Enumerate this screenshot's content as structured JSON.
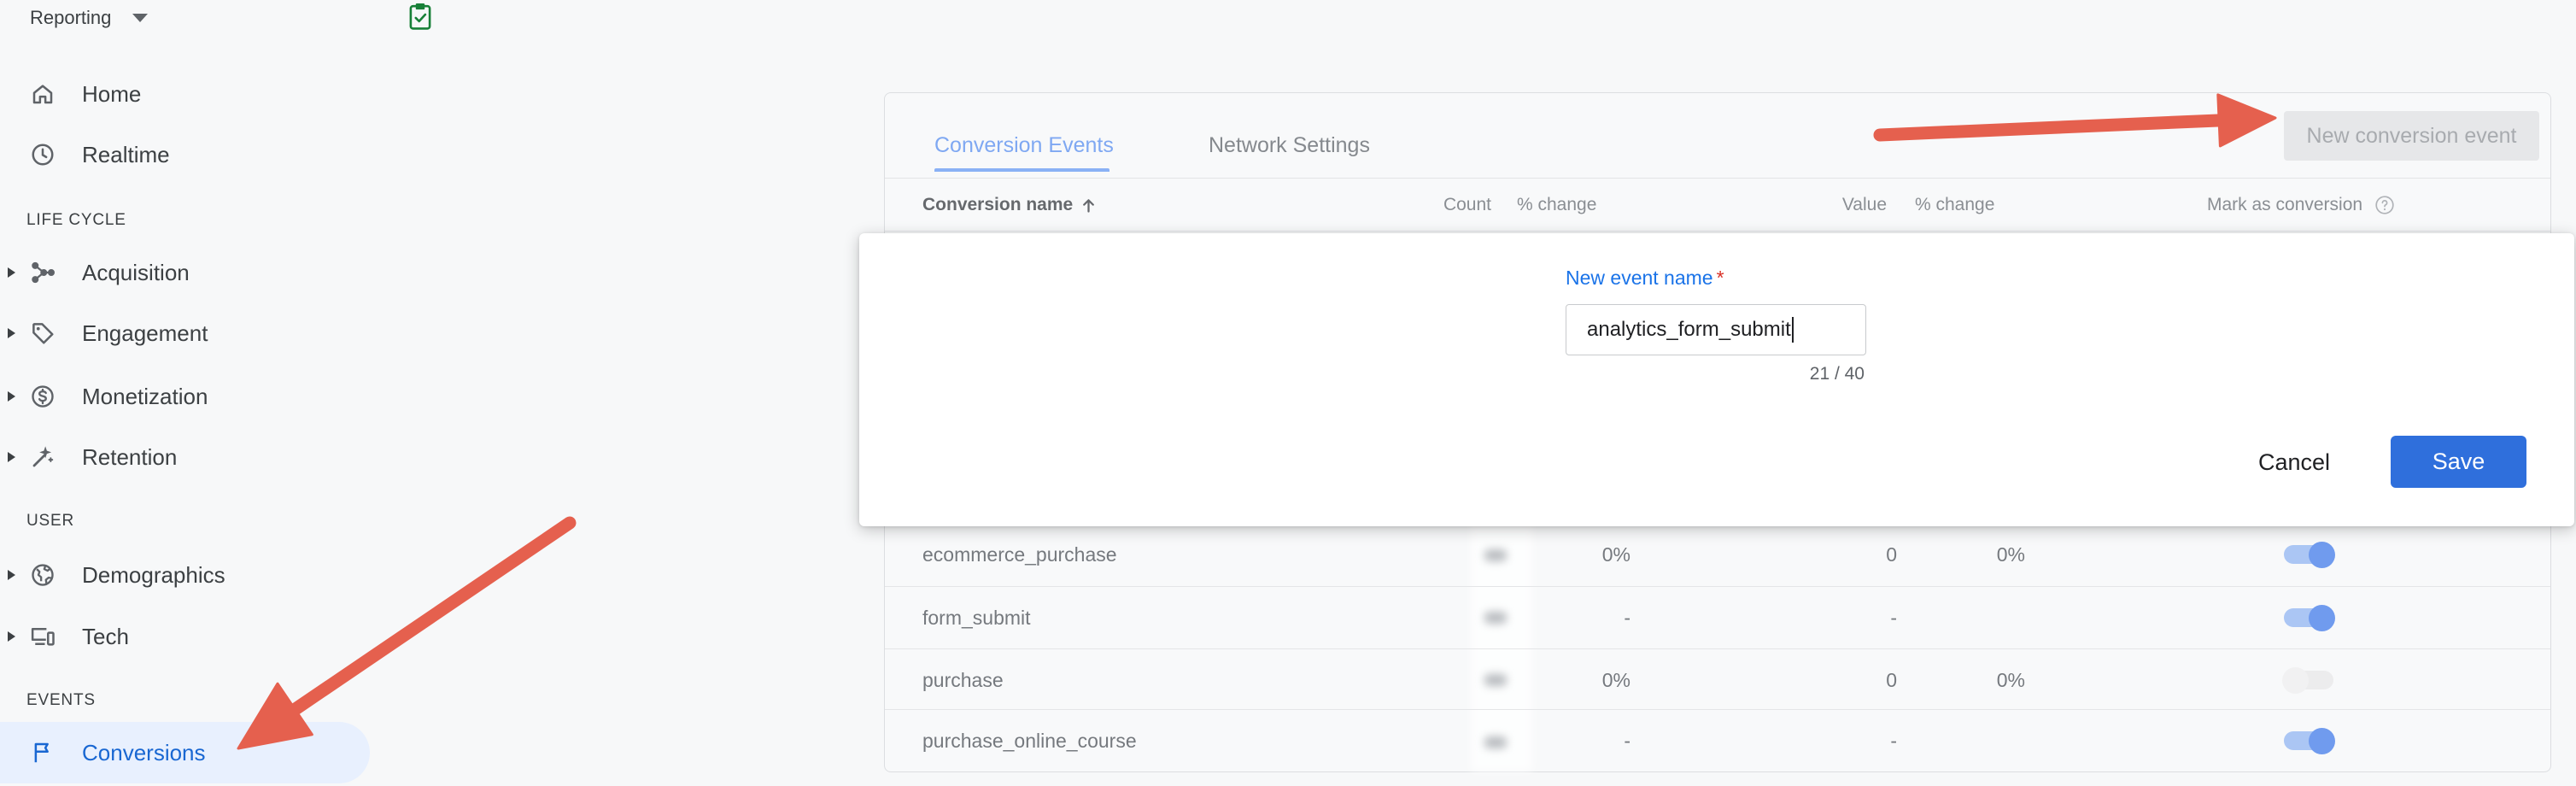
{
  "header": {
    "reporting_label": "Reporting",
    "report_icon": "clipboard-check-icon"
  },
  "sidebar": {
    "top": [
      {
        "label": "Home",
        "icon": "home-icon"
      },
      {
        "label": "Realtime",
        "icon": "clock-icon"
      }
    ],
    "sections": [
      {
        "title": "LIFE CYCLE",
        "items": [
          {
            "label": "Acquisition",
            "icon": "acquisition-icon",
            "expandable": true
          },
          {
            "label": "Engagement",
            "icon": "tag-icon",
            "expandable": true
          },
          {
            "label": "Monetization",
            "icon": "dollar-icon",
            "expandable": true
          },
          {
            "label": "Retention",
            "icon": "wand-icon",
            "expandable": true
          }
        ]
      },
      {
        "title": "USER",
        "items": [
          {
            "label": "Demographics",
            "icon": "globe-icon",
            "expandable": true
          },
          {
            "label": "Tech",
            "icon": "devices-icon",
            "expandable": true
          }
        ]
      },
      {
        "title": "EVENTS",
        "items": [
          {
            "label": "Conversions",
            "icon": "flag-icon",
            "active": true
          }
        ]
      }
    ]
  },
  "conversions_card": {
    "tabs": [
      {
        "label": "Conversion Events",
        "active": true
      },
      {
        "label": "Network Settings",
        "active": false
      }
    ],
    "new_event_button": {
      "label": "New conversion event",
      "disabled": true
    },
    "table": {
      "columns": {
        "name": "Conversion name",
        "count": "Count",
        "count_change": "% change",
        "value": "Value",
        "value_change": "% change",
        "mark": "Mark as conversion"
      },
      "sort_icon": "arrow-upward-icon",
      "help_icon": "help-circle-icon",
      "rows": [
        {
          "name": "ecommerce_purchase",
          "count_change": "0%",
          "value": "0",
          "value_change": "0%",
          "marked": true
        },
        {
          "name": "form_submit",
          "count_change": "-",
          "value": "-",
          "value_change": "",
          "marked": true
        },
        {
          "name": "purchase",
          "count_change": "0%",
          "value": "0",
          "value_change": "0%",
          "marked": false
        },
        {
          "name": "purchase_online_course",
          "count_change": "-",
          "value": "-",
          "value_change": "",
          "marked": true
        }
      ]
    }
  },
  "new_event_dialog": {
    "label": "New event name",
    "required_mark": "*",
    "value": "analytics_form_submit",
    "counter": "21 / 40",
    "cancel_label": "Cancel",
    "save_label": "Save"
  },
  "colors": {
    "accent": "#1a73e8",
    "save_button": "#2f6fdc",
    "required": "#d93025",
    "annotation_arrow": "#e5604e",
    "active_nav_bg": "#e8f0fe",
    "report_icon": "#188038"
  }
}
